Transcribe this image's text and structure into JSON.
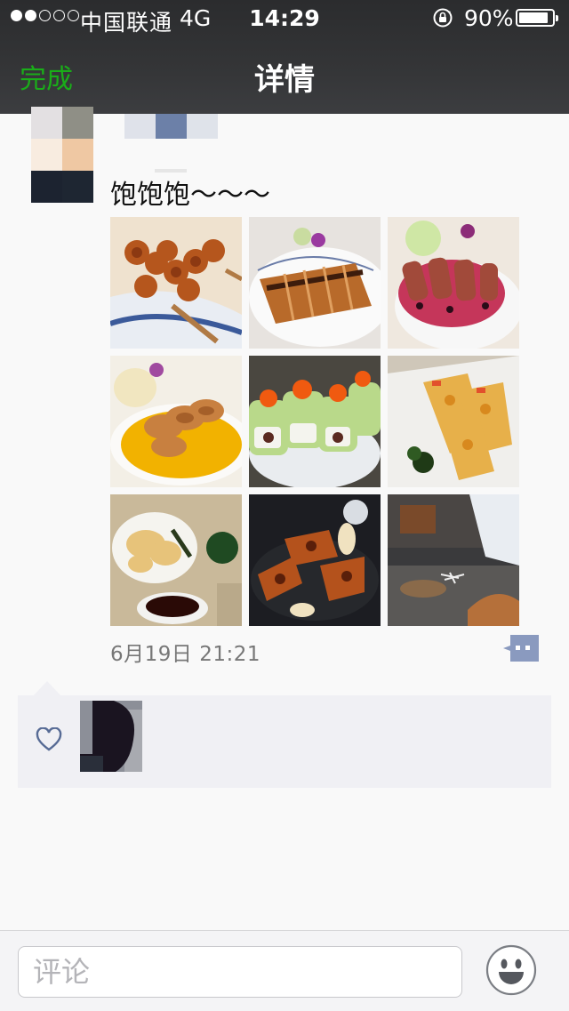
{
  "status_bar": {
    "signal_bars_filled": 2,
    "signal_bars_total": 5,
    "carrier": "中国联通",
    "network": "4G",
    "time": "14:29",
    "battery_percent": "90%",
    "battery_level": 0.9
  },
  "nav": {
    "back_label": "完成",
    "title": "详情"
  },
  "post": {
    "text": "饱饱饱～～～",
    "timestamp": "6月19日 21:21",
    "photos": [
      {
        "name": "photo-yakitori-skewers"
      },
      {
        "name": "photo-tonkatsu"
      },
      {
        "name": "photo-duck-berry-sauce"
      },
      {
        "name": "photo-duck-mango-sauce"
      },
      {
        "name": "photo-sushi-rolls"
      },
      {
        "name": "photo-baked-seafood"
      },
      {
        "name": "photo-tempura"
      },
      {
        "name": "photo-grilled-meat"
      },
      {
        "name": "photo-teppanyaki-grill"
      }
    ]
  },
  "likes": {
    "icon": "heart-icon"
  },
  "footer": {
    "comment_placeholder": "评论",
    "emoji_icon": "smiley-icon"
  },
  "colors": {
    "accent_green": "#1aad19",
    "link_blue": "#576b95",
    "topbar": "#333436"
  }
}
